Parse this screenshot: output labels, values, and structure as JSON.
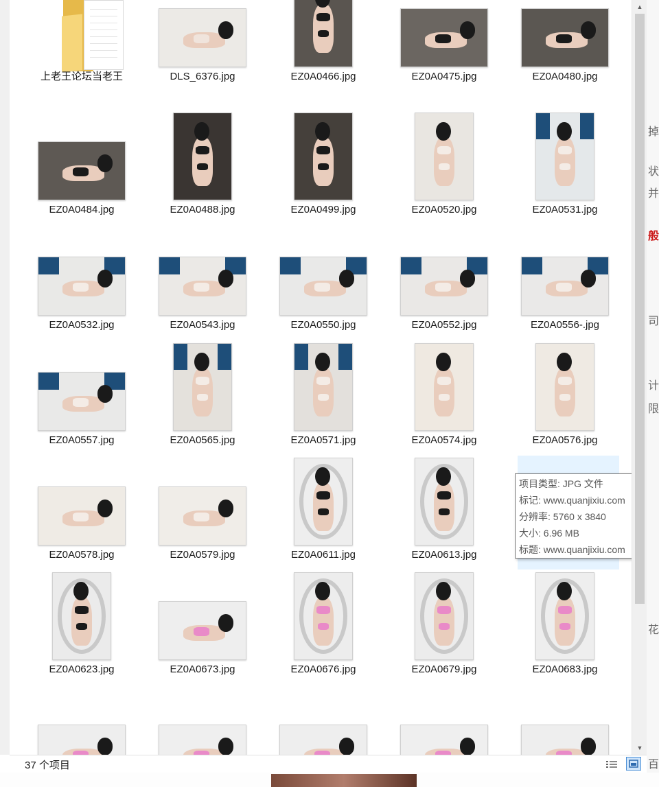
{
  "window": {
    "status_count": "37 个项目"
  },
  "items": [
    {
      "name": "上老王论坛当老王",
      "type": "folder"
    },
    {
      "name": "DLS_6376.jpg",
      "shape": "land",
      "bg": "#eceae6",
      "garment": "#f0e4dc",
      "windows": false,
      "ring": false
    },
    {
      "name": "EZ0A0466.jpg",
      "shape": "port",
      "bg": "#5a5550",
      "garment": "#1a1a1a",
      "windows": false,
      "ring": false
    },
    {
      "name": "EZ0A0475.jpg",
      "shape": "land",
      "bg": "#6b6661",
      "garment": "#1a1a1a",
      "windows": false,
      "ring": false
    },
    {
      "name": "EZ0A0480.jpg",
      "shape": "land",
      "bg": "#5b5752",
      "garment": "#1a1a1a",
      "windows": false,
      "ring": false
    },
    {
      "name": "EZ0A0484.jpg",
      "shape": "land",
      "bg": "#5e5954",
      "garment": "#1a1a1a",
      "windows": false,
      "ring": false
    },
    {
      "name": "EZ0A0488.jpg",
      "shape": "port",
      "bg": "#3a3532",
      "garment": "#1a1a1a",
      "windows": false,
      "ring": false
    },
    {
      "name": "EZ0A0499.jpg",
      "shape": "port",
      "bg": "#45403b",
      "garment": "#1a1a1a",
      "windows": false,
      "ring": false
    },
    {
      "name": "EZ0A0520.jpg",
      "shape": "port",
      "bg": "#e9e6e1",
      "garment": "#f4ece6",
      "windows": false,
      "ring": false
    },
    {
      "name": "EZ0A0531.jpg",
      "shape": "port",
      "bg": "#e4e8ea",
      "garment": "#f4ece6",
      "windows": true,
      "ring": false
    },
    {
      "name": "EZ0A0532.jpg",
      "shape": "land",
      "bg": "#e9e9e7",
      "garment": "#f4ece6",
      "windows": true,
      "ring": false
    },
    {
      "name": "EZ0A0543.jpg",
      "shape": "land",
      "bg": "#ebe9e6",
      "garment": "#f4ece6",
      "windows": true,
      "ring": false
    },
    {
      "name": "EZ0A0550.jpg",
      "shape": "land",
      "bg": "#e9e9e8",
      "garment": "#f4ece6",
      "windows": true,
      "ring": false
    },
    {
      "name": "EZ0A0552.jpg",
      "shape": "land",
      "bg": "#eae8e6",
      "garment": "#f4ece6",
      "windows": true,
      "ring": false
    },
    {
      "name": "EZ0A0556-.jpg",
      "shape": "land",
      "bg": "#eae9e8",
      "garment": "#f4ece6",
      "windows": true,
      "ring": false
    },
    {
      "name": "EZ0A0557.jpg",
      "shape": "land",
      "bg": "#e9e9e8",
      "garment": "#f4ece6",
      "windows": true,
      "ring": false
    },
    {
      "name": "EZ0A0565.jpg",
      "shape": "port",
      "bg": "#e4e1dc",
      "garment": "#f4ece6",
      "windows": true,
      "ring": false
    },
    {
      "name": "EZ0A0571.jpg",
      "shape": "port",
      "bg": "#e3e0dc",
      "garment": "#f4ece6",
      "windows": true,
      "ring": false
    },
    {
      "name": "EZ0A0574.jpg",
      "shape": "port",
      "bg": "#efe9e1",
      "garment": "#f4ece6",
      "windows": false,
      "ring": false
    },
    {
      "name": "EZ0A0576.jpg",
      "shape": "port",
      "bg": "#efeae3",
      "garment": "#f4ece6",
      "windows": false,
      "ring": false
    },
    {
      "name": "EZ0A0578.jpg",
      "shape": "land",
      "bg": "#efebe5",
      "garment": "#f4ece6",
      "windows": false,
      "ring": false
    },
    {
      "name": "EZ0A0579.jpg",
      "shape": "land",
      "bg": "#f0ede8",
      "garment": "#f4ece6",
      "windows": false,
      "ring": false
    },
    {
      "name": "EZ0A0611.jpg",
      "shape": "port",
      "bg": "#eeeeee",
      "garment": "#1a1a1a",
      "windows": false,
      "ring": true
    },
    {
      "name": "EZ0A0613.jpg",
      "shape": "port",
      "bg": "#ededed",
      "garment": "#1a1a1a",
      "windows": false,
      "ring": true
    },
    {
      "name": "",
      "shape": "hidden"
    },
    {
      "name": "EZ0A0623.jpg",
      "shape": "port",
      "bg": "#ebebeb",
      "garment": "#1a1a1a",
      "windows": false,
      "ring": true
    },
    {
      "name": "EZ0A0673.jpg",
      "shape": "land",
      "bg": "#eeeeee",
      "garment": "#e98ac8",
      "windows": false,
      "ring": false
    },
    {
      "name": "EZ0A0676.jpg",
      "shape": "port",
      "bg": "#ededed",
      "garment": "#e98ac8",
      "windows": false,
      "ring": true
    },
    {
      "name": "EZ0A0679.jpg",
      "shape": "port",
      "bg": "#ececec",
      "garment": "#e98ac8",
      "windows": false,
      "ring": true
    },
    {
      "name": "EZ0A0683.jpg",
      "shape": "port",
      "bg": "#eeeeee",
      "garment": "#e98ac8",
      "windows": false,
      "ring": true
    },
    {
      "name": "",
      "shape": "land",
      "bg": "#eeeeee",
      "garment": "#e98ac8",
      "windows": false,
      "ring": false
    },
    {
      "name": "",
      "shape": "land",
      "bg": "#efefef",
      "garment": "#e98ac8",
      "windows": false,
      "ring": false
    },
    {
      "name": "",
      "shape": "land",
      "bg": "#eeeeee",
      "garment": "#e98ac8",
      "windows": false,
      "ring": false
    },
    {
      "name": "",
      "shape": "land",
      "bg": "#efefef",
      "garment": "#e98ac8",
      "windows": false,
      "ring": false
    },
    {
      "name": "",
      "shape": "land",
      "bg": "#eeeeee",
      "garment": "#e98ac8",
      "windows": false,
      "ring": false
    }
  ],
  "tooltip": {
    "type_line": "项目类型: JPG 文件",
    "tags_line": "标记: www.quanjixiu.com",
    "resolution_line": "分辨率: 5760 x 3840",
    "size_line": "大小: 6.96 MB",
    "title_line": "标题: www.quanjixiu.com"
  },
  "right_strip": {
    "chars": [
      "掉",
      "状",
      "并",
      "般",
      "司",
      "计",
      "限",
      "花",
      "百"
    ]
  },
  "colors": {
    "hover": "#e5f3ff",
    "selected_view": "#cfe5fb",
    "accent_red": "#cc1b1b"
  },
  "icons": {
    "details_view": "details-view-icon",
    "large_icons_view": "large-icons-view-icon",
    "scroll_up": "scroll-up-arrow-icon",
    "scroll_down": "scroll-down-arrow-icon"
  }
}
